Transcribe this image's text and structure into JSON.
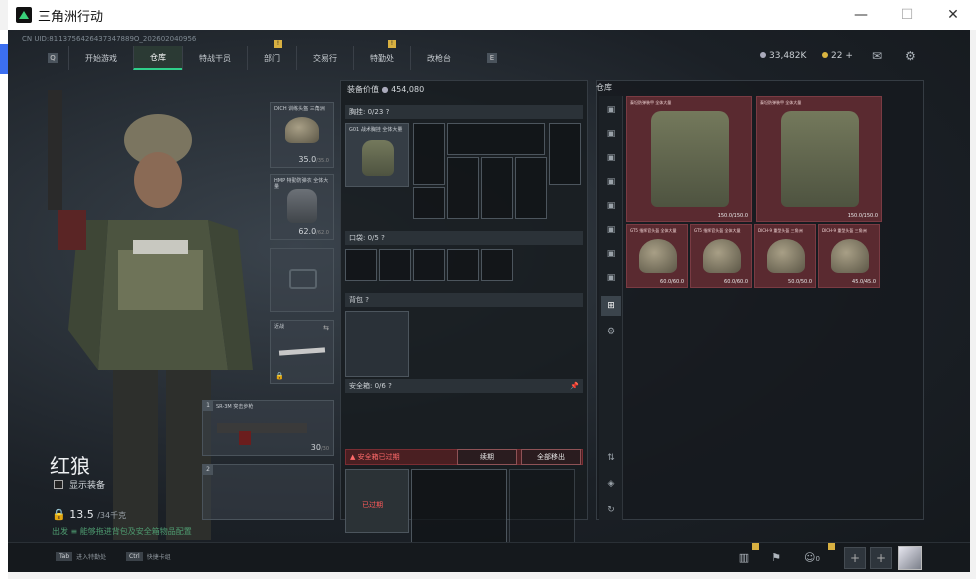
{
  "window": {
    "title": "三角洲行动",
    "minimize": "—",
    "maximize": "☐",
    "close": "✕"
  },
  "game": {
    "uid": "CN UID:8113756426437347889O_202602040956",
    "nav": {
      "tabs": [
        {
          "label": "开始游戏",
          "active": false,
          "badge": ""
        },
        {
          "label": "仓库",
          "active": true,
          "badge": ""
        },
        {
          "label": "特战干员",
          "active": false,
          "badge": ""
        },
        {
          "label": "部门",
          "active": false,
          "badge": "!"
        },
        {
          "label": "交易行",
          "active": false,
          "badge": ""
        },
        {
          "label": "特勤处",
          "active": false,
          "badge": "!"
        },
        {
          "label": "改枪台",
          "active": false,
          "badge": ""
        }
      ],
      "left_key": "Q",
      "right_key": "E"
    },
    "currency": {
      "coins": "33,482K",
      "gold": "22 +"
    },
    "operator": {
      "name": "红狼",
      "show_gear_label": "显示装备",
      "weight": "13.5",
      "weight_max": "/34千克",
      "note": "出发 ≡ 能够拖进背包及安全箱物品配置"
    },
    "gear_slots": {
      "helmet": {
        "label": "DICH 训练头盔\n三角洲",
        "durability": "35.0",
        "max": "/35.0"
      },
      "armor": {
        "label": "HMP 特勤防弹衣\n全体大量",
        "durability": "62.0",
        "max": "/62.0"
      },
      "pistol": {
        "label": ""
      },
      "melee": {
        "label": "近战"
      },
      "primary": {
        "label": "SR-3M\n突击步枪",
        "ammo": "30",
        "ammo_max": "/30",
        "slot_no": "1"
      },
      "secondary": {
        "label": "",
        "slot_no": "2"
      }
    },
    "middle": {
      "equipment_value_label": "装备价值",
      "equipment_value": "454,080",
      "chest_rig_label": "胸挂: ",
      "chest_rig_count": "0/23",
      "chest_rig_item": "G01 战术胸挂\n全体大量",
      "pockets_label": "口袋: ",
      "pockets_count": "0/5",
      "backpack_label": "背包",
      "safebox_label": "安全箱: ",
      "safebox_count": "0/6",
      "safebox_warning": "安全箱已过期",
      "renew_button": "续期",
      "move_all_button": "全部移出",
      "expired_badge": "已过期"
    },
    "storage": {
      "title": "仓库",
      "items": [
        {
          "label": "泰坦防弹装甲\n全体大量",
          "durability": "150.0/150.0",
          "kind": "vest"
        },
        {
          "label": "泰坦防弹装甲\n全体大量",
          "durability": "150.0/150.0",
          "kind": "vest"
        },
        {
          "label": "GT5 指挥官头盔\n全体大量",
          "durability": "60.0/60.0",
          "kind": "helmet"
        },
        {
          "label": "GT5 指挥官头盔\n全体大量",
          "durability": "60.0/60.0",
          "kind": "helmet"
        },
        {
          "label": "DICH-9 重型头盔\n三角洲",
          "durability": "50.0/50.0",
          "kind": "helmet"
        },
        {
          "label": "DICH-9 重型头盔\n三角洲",
          "durability": "45.0/45.0",
          "kind": "helmet"
        }
      ]
    },
    "bottom": {
      "key1": "Tab",
      "key1_label": "进入特勤处",
      "key2": "Ctrl",
      "key2_label": "快捷卡组",
      "friends_count": "0"
    }
  }
}
